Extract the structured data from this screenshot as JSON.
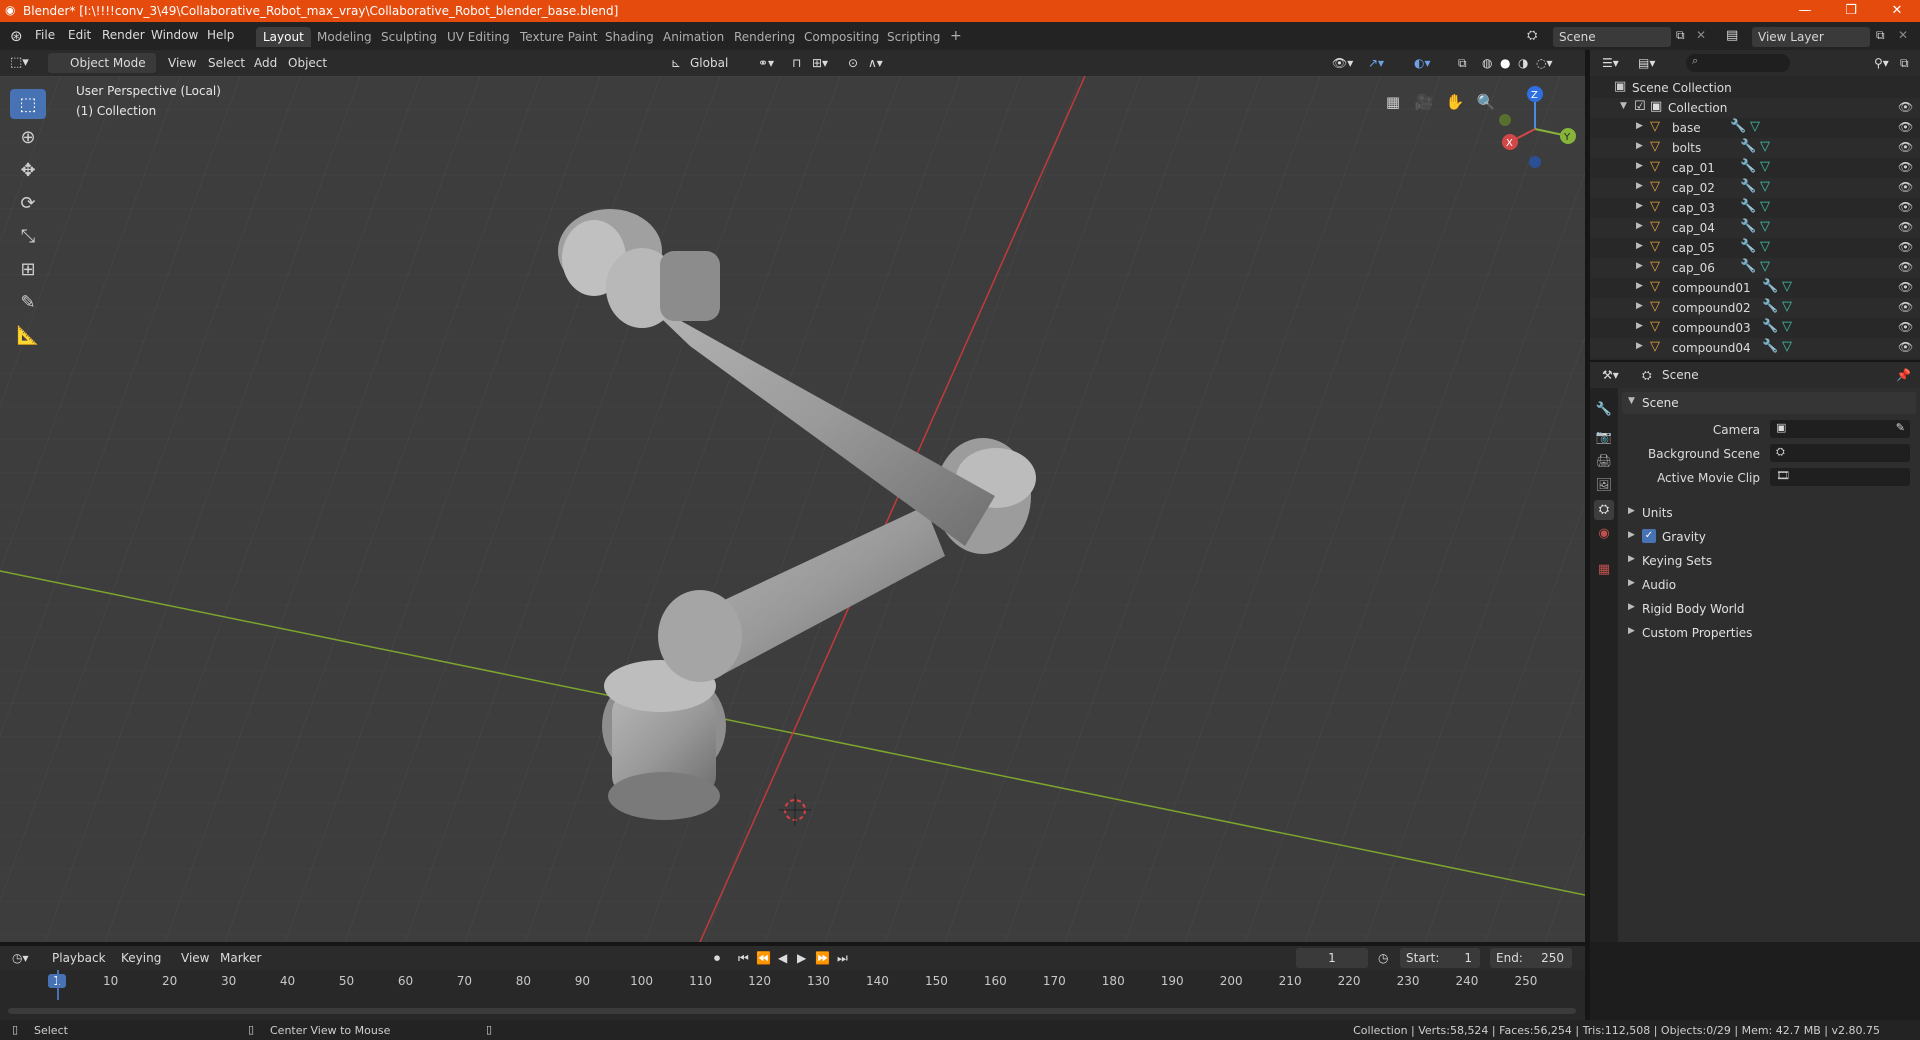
{
  "window": {
    "title": "Blender* [I:\\!!!!conv_3\\49\\Collaborative_Robot_max_vray\\Collaborative_Robot_blender_base.blend]",
    "minimize": "—",
    "restore": "❐",
    "close": "✕"
  },
  "menu": [
    "File",
    "Edit",
    "Render",
    "Window",
    "Help"
  ],
  "workspaces": [
    "Layout",
    "Modeling",
    "Sculpting",
    "UV Editing",
    "Texture Paint",
    "Shading",
    "Animation",
    "Rendering",
    "Compositing",
    "Scripting"
  ],
  "active_workspace": "Layout",
  "add_workspace": "+",
  "scene_selector": "Scene",
  "view_layer_selector": "View Layer",
  "viewport_header": {
    "mode": "Object Mode",
    "menus": [
      "View",
      "Select",
      "Add",
      "Object"
    ],
    "orientation": "Global"
  },
  "viewport": {
    "perspective_label": "User Perspective (Local)",
    "collection_label": "(1) Collection",
    "gizmo": {
      "x": "X",
      "y": "Y",
      "z": "Z"
    }
  },
  "outliner": {
    "root": "Scene Collection",
    "collection": "Collection",
    "items": [
      "base",
      "bolts",
      "cap_01",
      "cap_02",
      "cap_03",
      "cap_04",
      "cap_05",
      "cap_06",
      "compound01",
      "compound02",
      "compound03",
      "compound04"
    ]
  },
  "properties": {
    "context": "Scene",
    "panel_title": "Scene",
    "fields": [
      {
        "label": "Camera",
        "value": ""
      },
      {
        "label": "Background Scene",
        "value": ""
      },
      {
        "label": "Active Movie Clip",
        "value": ""
      }
    ],
    "subpanels": [
      "Units",
      "Gravity",
      "Keying Sets",
      "Audio",
      "Rigid Body World",
      "Custom Properties"
    ],
    "gravity_checked": true
  },
  "timeline": {
    "menus": [
      "Playback",
      "Keying",
      "View",
      "Marker"
    ],
    "current_frame": "1",
    "start_label": "Start:",
    "start": "1",
    "end_label": "End:",
    "end": "250",
    "ticks": [
      "1",
      "10",
      "20",
      "30",
      "40",
      "50",
      "60",
      "70",
      "80",
      "90",
      "100",
      "110",
      "120",
      "130",
      "140",
      "150",
      "160",
      "170",
      "180",
      "190",
      "200",
      "210",
      "220",
      "230",
      "240",
      "250"
    ]
  },
  "statusbar": {
    "left_action": "Select",
    "middle_action": "Center View to Mouse",
    "stats": "Collection | Verts:58,524 | Faces:56,254 | Tris:112,508 | Objects:0/29 | Mem: 42.7 MB | v2.80.75"
  },
  "colors": {
    "title_bar": "#e64b0e",
    "accent": "#4772b3",
    "x_axis": "#c23a3a",
    "y_axis": "#7da52e"
  }
}
